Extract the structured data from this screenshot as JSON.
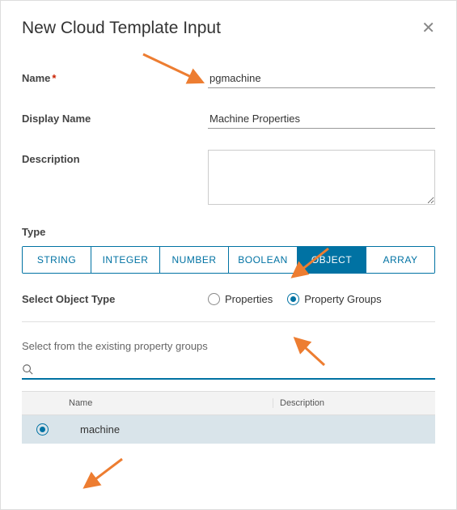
{
  "modal": {
    "title": "New Cloud Template Input"
  },
  "form": {
    "name_label": "Name",
    "name_value": "pgmachine",
    "display_name_label": "Display Name",
    "display_name_value": "Machine Properties",
    "description_label": "Description",
    "description_value": ""
  },
  "type": {
    "label": "Type",
    "options": [
      "STRING",
      "INTEGER",
      "NUMBER",
      "BOOLEAN",
      "OBJECT",
      "ARRAY"
    ],
    "selected": "OBJECT"
  },
  "object_type": {
    "label": "Select Object Type",
    "options": [
      {
        "value": "properties",
        "label": "Properties"
      },
      {
        "value": "property_groups",
        "label": "Property Groups"
      }
    ],
    "selected": "property_groups"
  },
  "property_groups_section": {
    "heading": "Select from the existing property groups",
    "search_value": "",
    "columns": {
      "name": "Name",
      "description": "Description"
    },
    "rows": [
      {
        "name": "machine",
        "description": "",
        "selected": true
      }
    ]
  }
}
